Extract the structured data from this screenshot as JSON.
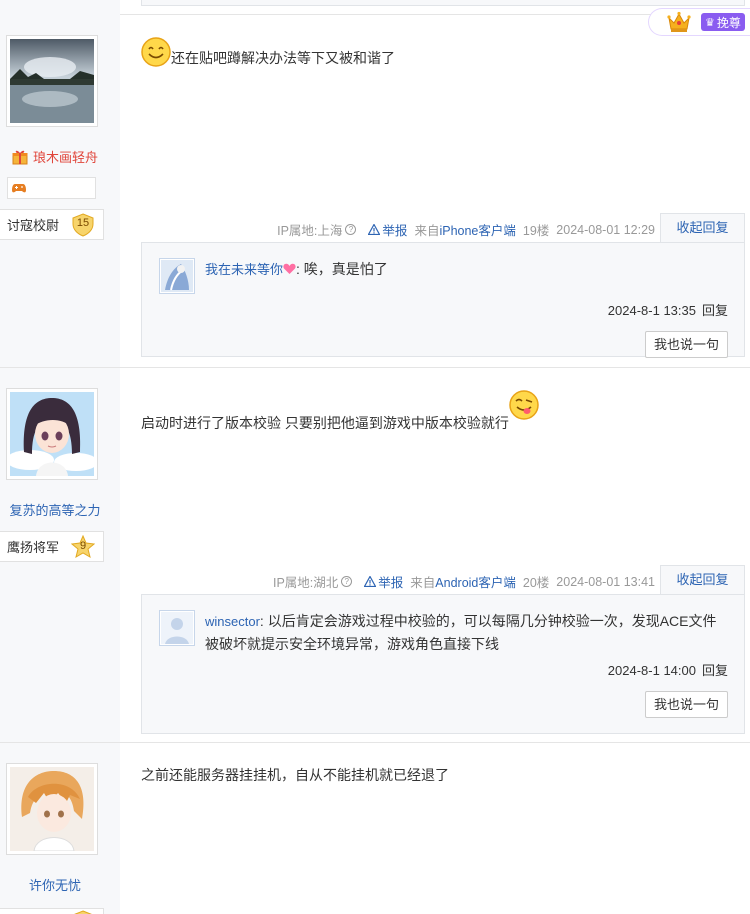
{
  "vip": {
    "icon": "crown-icon",
    "label": "挽尊",
    "glyph": "♛"
  },
  "posts": [
    {
      "username": "琅木画轻舟",
      "rank_title": "讨寇校尉",
      "rank_level": "15",
      "content": "还在贴吧蹲解决办法等下又被和谐了",
      "ip": "IP属地:上海",
      "report": "举报",
      "client_prefix": "来自",
      "client": "iPhone客户端",
      "floor": "19楼",
      "time": "2024-08-01 12:29",
      "collapse": "收起回复",
      "reply": {
        "user": "我在未来等你",
        "text": ": 唉，真是怕了",
        "time": "2024-8-1 13:35",
        "action": "回复"
      },
      "say_button": "我也说一句"
    },
    {
      "username": "复苏的高等之力",
      "rank_title": "鹰扬将军",
      "rank_level": "9",
      "content": "启动时进行了版本校验 只要别把他逼到游戏中版本校验就行",
      "ip": "IP属地:湖北",
      "report": "举报",
      "client_prefix": "来自",
      "client": "Android客户端",
      "floor": "20楼",
      "time": "2024-08-01 13:41",
      "collapse": "收起回复",
      "reply": {
        "user": "winsector",
        "text": ": 以后肯定会游戏过程中校验的，可以每隔几分钟校验一次，发现ACE文件被破坏就提示安全环境异常，游戏角色直接下线",
        "time": "2024-8-1 14:00",
        "action": "回复"
      },
      "say_button": "我也说一句"
    },
    {
      "username": "许你无忧",
      "content": "之前还能服务器挂挂机，自从不能挂机就已经退了"
    }
  ]
}
